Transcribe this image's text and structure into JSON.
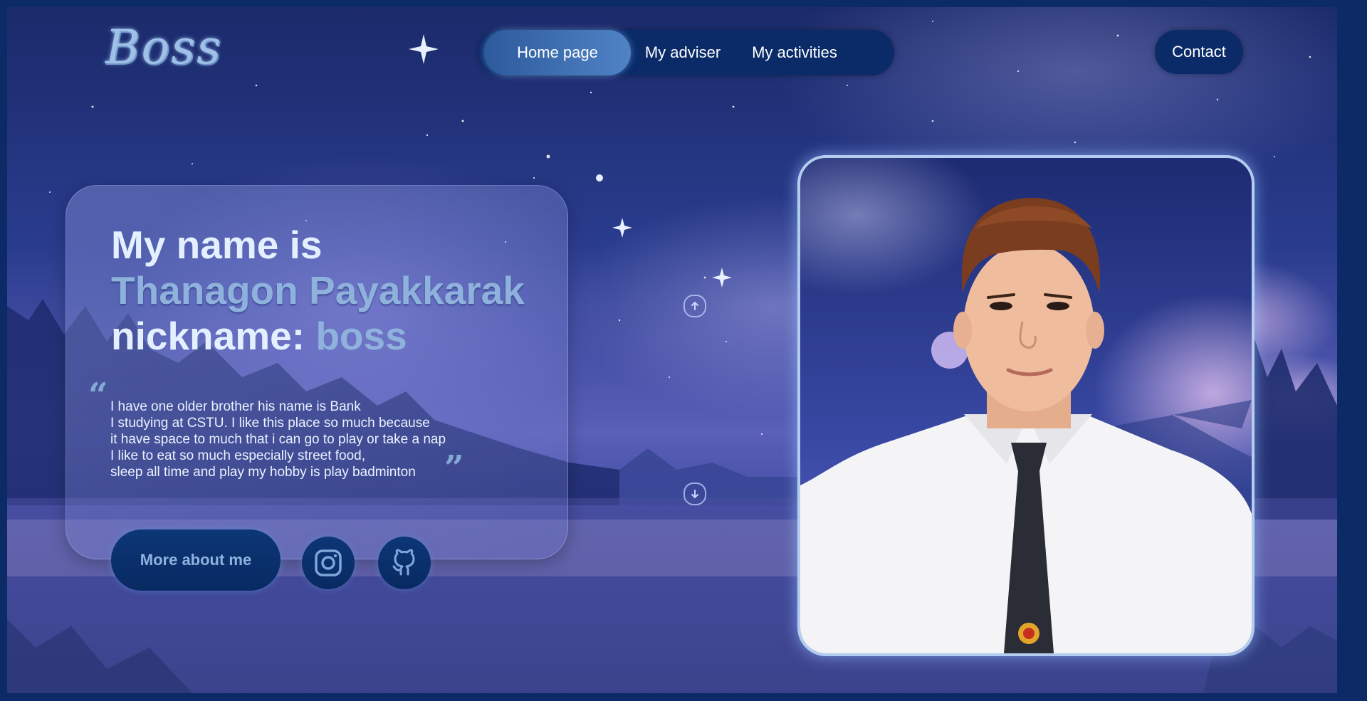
{
  "logo": {
    "text": "Boss"
  },
  "nav": {
    "items": [
      {
        "label": "Home page",
        "active": true
      },
      {
        "label": "My adviser",
        "active": false
      },
      {
        "label": "My activities",
        "active": false
      }
    ],
    "contact_label": "Contact"
  },
  "hero": {
    "line1": "My name is",
    "name": "Thanagon Payakkarak",
    "nickname_label": "nickname:",
    "nickname": "boss",
    "bio_lines": [
      "I have one older brother his name is Bank",
      "I studying at CSTU. I like this place so much because",
      "it have space to much that i can go to play or take a nap",
      "I like to eat so much especially street food,",
      "sleep all time and play my hobby is play badminton"
    ],
    "quote_open": "“",
    "quote_close": "”",
    "more_button": "More about me"
  },
  "social": [
    {
      "icon": "instagram-icon"
    },
    {
      "icon": "github-icon"
    }
  ],
  "scroll_controls": [
    {
      "icon": "arrow-up-icon"
    },
    {
      "icon": "arrow-down-icon"
    }
  ],
  "profile_photo": {
    "subject": "student portrait"
  },
  "colors": {
    "accent": "#4f83c5",
    "nav_bg": "#0a2b68",
    "name_color": "#8fb2dd",
    "heading_color": "#e4f0ff"
  }
}
